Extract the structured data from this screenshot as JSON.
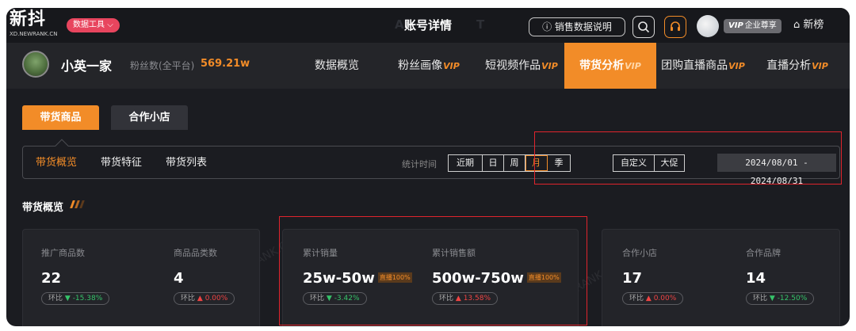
{
  "topbar": {
    "logo_text": "新抖",
    "logo_sub": "XD.NEWRANK.CN",
    "tools_label": "数据工具",
    "title": "账号详情",
    "explain_label": "销售数据说明",
    "vip_label": "企业尊享",
    "vip_prefix": "VIP",
    "newlist_label": "新榜"
  },
  "account": {
    "name": "小英一家",
    "fans_label": "粉丝数(全平台)",
    "fans_value": "569.21w"
  },
  "nav_tabs": [
    {
      "label": "数据概览",
      "vip": ""
    },
    {
      "label": "粉丝画像",
      "vip": "VIP"
    },
    {
      "label": "短视频作品",
      "vip": "VIP"
    },
    {
      "label": "带货分析",
      "vip": "VIP"
    },
    {
      "label": "团购直播商品",
      "vip": "VIP"
    },
    {
      "label": "直播分析",
      "vip": "VIP"
    }
  ],
  "sub_tabs": [
    "带货商品",
    "合作小店"
  ],
  "filter": {
    "tabs": [
      "带货概览",
      "带货特征",
      "带货列表"
    ],
    "stat_label": "统计时间",
    "seg1": [
      "近期",
      "日",
      "周",
      "月",
      "季"
    ],
    "seg2": [
      "自定义",
      "大促"
    ],
    "date_range": "2024/08/01 - 2024/08/31"
  },
  "section_title": "带货概览",
  "metrics": [
    {
      "label": "推广商品数",
      "value": "22",
      "tag": "",
      "pill_prefix": "环比",
      "dir": "down",
      "change": "-15.38%"
    },
    {
      "label": "商品品类数",
      "value": "4",
      "tag": "",
      "pill_prefix": "环比",
      "dir": "up",
      "change": "0.00%"
    },
    {
      "label": "累计销量",
      "value": "25w-50w",
      "tag": "直播100%",
      "pill_prefix": "环比",
      "dir": "down",
      "change": "-3.42%"
    },
    {
      "label": "累计销售额",
      "value": "500w-750w",
      "tag": "直播100%",
      "pill_prefix": "环比",
      "dir": "up",
      "change": "13.58%"
    },
    {
      "label": "合作小店",
      "value": "17",
      "tag": "",
      "pill_prefix": "环比",
      "dir": "up",
      "change": "0.00%"
    },
    {
      "label": "合作品牌",
      "value": "14",
      "tag": "",
      "pill_prefix": "环比",
      "dir": "down",
      "change": "-12.50%"
    }
  ],
  "watermark": "XD.NEWRANK.CN",
  "colors": {
    "accent": "#f28c28",
    "highlight_box": "#e0242c",
    "up": "#ef4444",
    "down": "#36c46a"
  }
}
